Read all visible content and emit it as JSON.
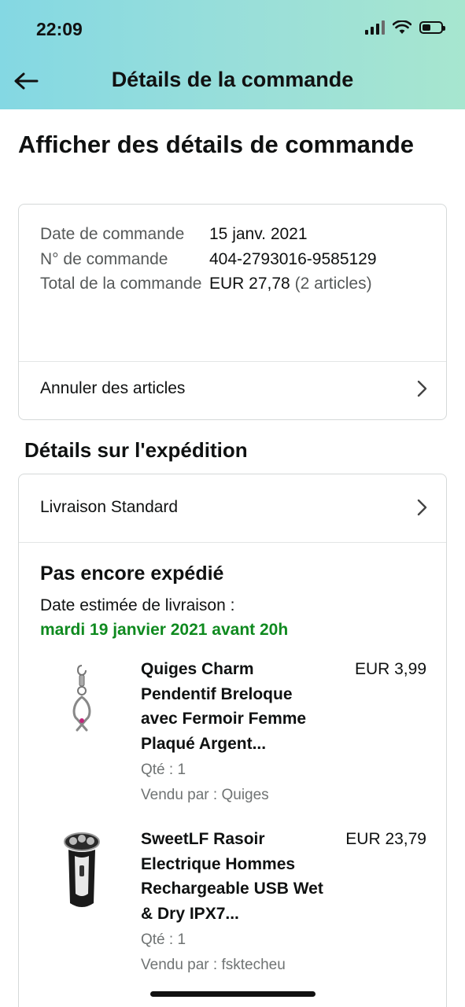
{
  "status_bar": {
    "time": "22:09"
  },
  "nav": {
    "title": "Détails de la commande"
  },
  "page_title": "Afficher des détails de commande",
  "order_summary": {
    "rows": [
      {
        "label": "Date de commande",
        "value": "15 janv. 2021",
        "extra": ""
      },
      {
        "label": "N° de commande",
        "value": "404-2793016-9585129",
        "extra": ""
      },
      {
        "label": "Total de la commande",
        "value": "EUR 27,78",
        "extra": "(2 articles)"
      }
    ],
    "cancel_label": "Annuler des articles"
  },
  "shipping": {
    "section_title": "Détails sur l'expédition",
    "method_label": "Livraison Standard",
    "status": "Pas encore expédié",
    "estimated_label": "Date estimée de livraison :",
    "estimated_date": "mardi 19 janvier 2021 avant 20h",
    "estimated_color": "#0f8a1f"
  },
  "items": [
    {
      "title": "Quiges Charm Pendentif Breloque avec Fermoir Femme Plaqué Argent...",
      "price": "EUR 3,99",
      "qty": "Qté : 1",
      "seller": "Vendu par : Quiges",
      "icon": "pendant-charm-image"
    },
    {
      "title": "SweetLF Rasoir Electrique Hommes Rechargeable USB Wet & Dry IPX7...",
      "price": "EUR 23,79",
      "qty": "Qté : 1",
      "seller": "Vendu par : fsktecheu",
      "icon": "electric-shaver-image"
    }
  ],
  "colors": {
    "header_start": "#84d8e3",
    "header_end": "#a7e6cf",
    "text": "#0f1111",
    "border": "#d5d9d9"
  }
}
